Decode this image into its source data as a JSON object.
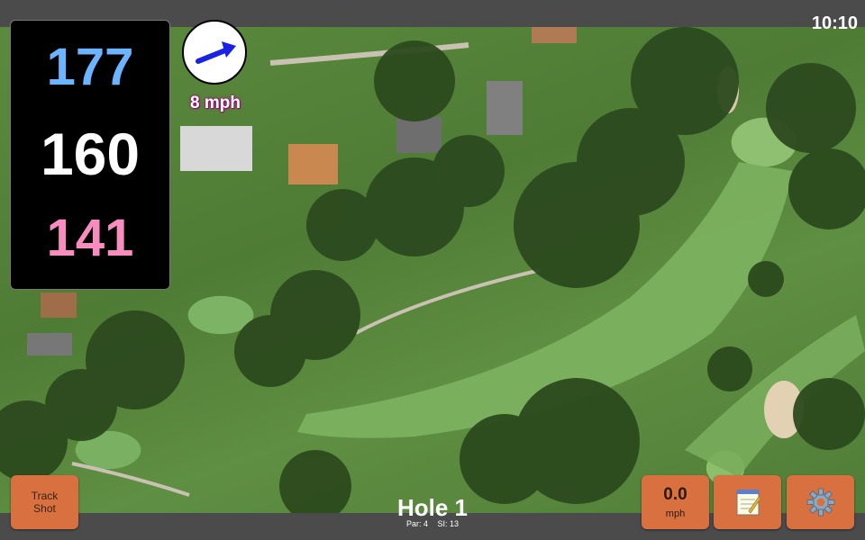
{
  "status": {
    "clock": "10:10"
  },
  "distances": {
    "back": "177",
    "middle": "160",
    "front": "141"
  },
  "wind": {
    "speed_label": "8 mph",
    "icon": "wind-arrow-icon"
  },
  "hole": {
    "title": "Hole 1",
    "par": "Par: 4",
    "si": "SI: 13"
  },
  "buttons": {
    "track_shot": {
      "line1": "Track",
      "line2": "Shot"
    },
    "speed": {
      "value": "0.0",
      "unit": "mph"
    },
    "notes": {
      "icon": "notepad-icon"
    },
    "settings": {
      "icon": "gear-icon"
    }
  },
  "colors": {
    "back_distance": "#6cb4ff",
    "middle_distance": "#ffffff",
    "front_distance": "#f78cbf",
    "button_bg": "#d87040",
    "bar_bg": "#4b4b4b"
  }
}
